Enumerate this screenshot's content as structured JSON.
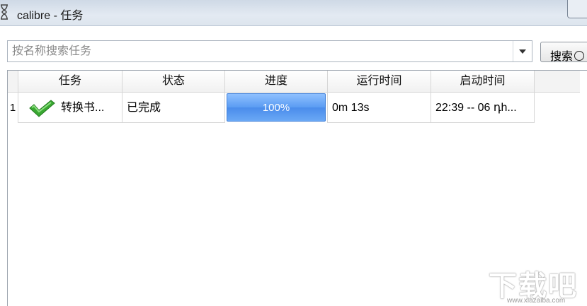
{
  "window": {
    "title": "calibre - 任务"
  },
  "search": {
    "placeholder": "按名称搜索任务",
    "button_label": "搜索",
    "button_icon": "clear-search-icon"
  },
  "table": {
    "columns": [
      "任务",
      "状态",
      "进度",
      "运行时间",
      "启动时间"
    ],
    "rows": [
      {
        "index": "1",
        "icon": "check-icon",
        "task": "转换书...",
        "status": "已完成",
        "progress_text": "100%",
        "progress_value": 100,
        "runtime": "0m 13s",
        "start_time": "22:39 -- 06 դh..."
      }
    ]
  },
  "watermark": {
    "text": "下载吧",
    "url": "www.xiazaiba.com"
  },
  "colors": {
    "progress_fill": "#5a9cf2",
    "check_green": "#3aa832"
  }
}
